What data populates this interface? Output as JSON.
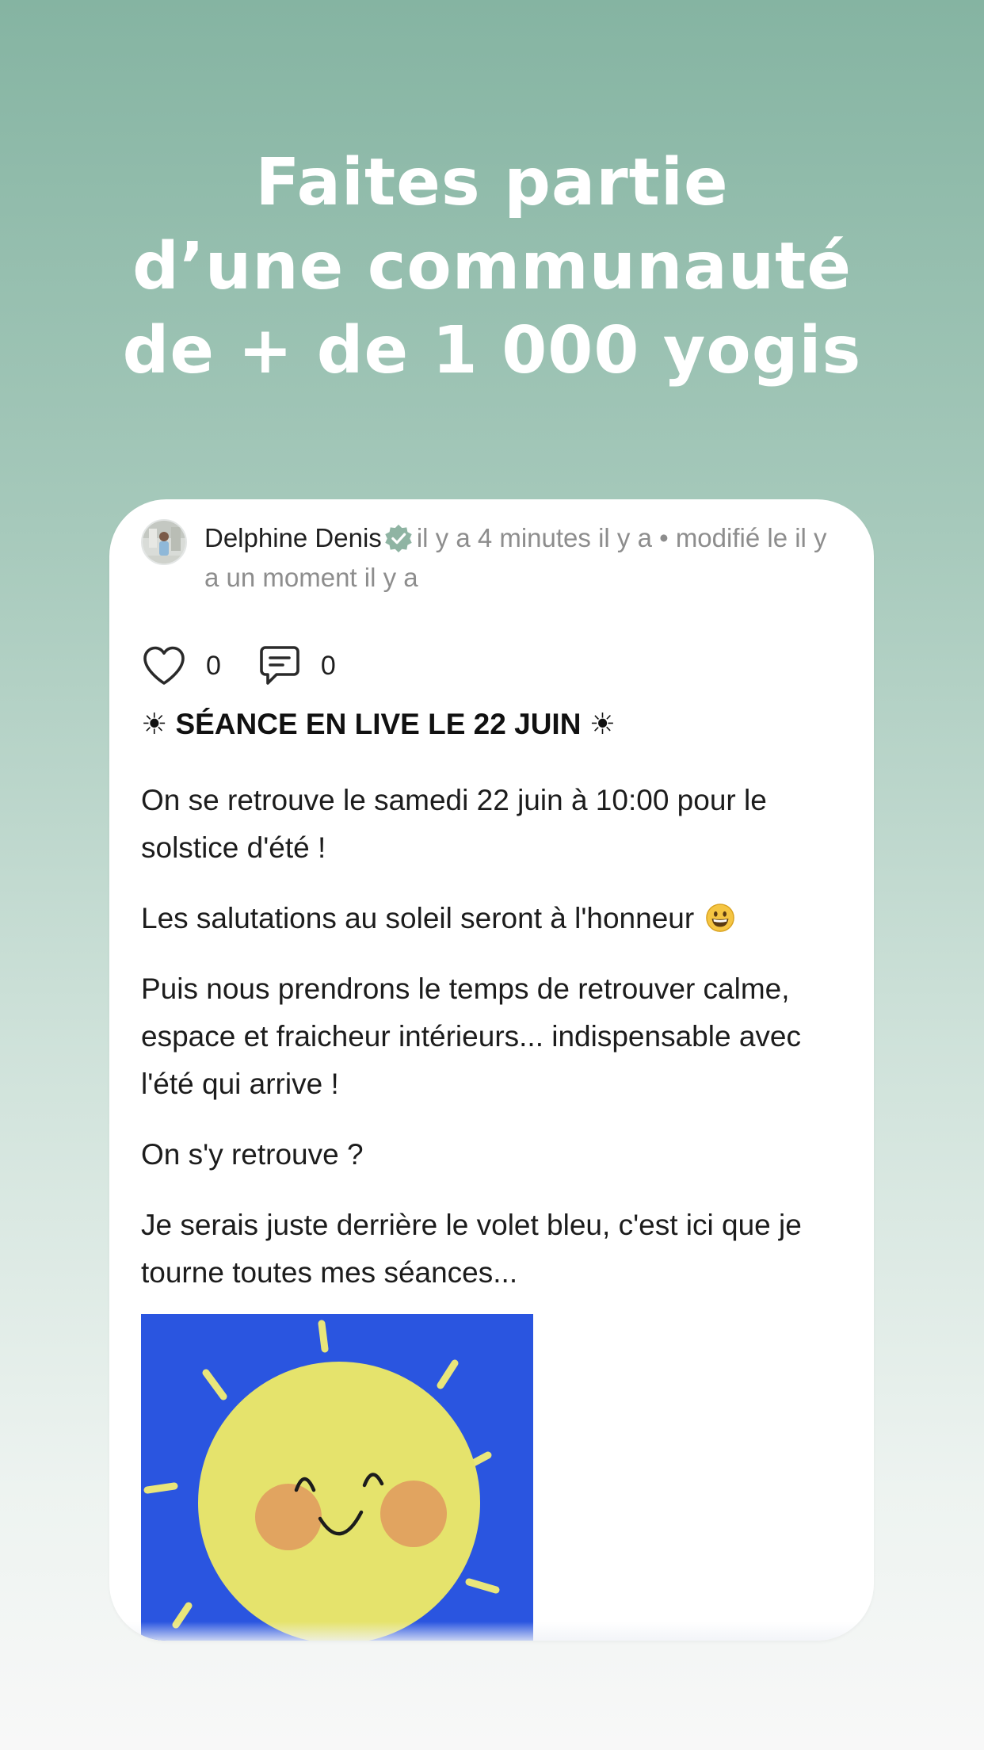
{
  "hero": {
    "title_lines": [
      "Faites partie",
      "d’une communauté",
      "de + de 1 000 yogis"
    ]
  },
  "post": {
    "author": "Delphine Denis",
    "meta_time": "il y a 4 minutes il y a • modifié le il y a un moment il y a",
    "likes": "0",
    "comments": "0",
    "title": "☀ SÉANCE EN LIVE LE 22 JUIN ☀",
    "paragraphs": [
      "On se retrouve le samedi 22 juin à 10:00 pour le solstice d'été !",
      "Les salutations au soleil seront à l'honneur",
      "Puis nous prendrons le temps de retrouver calme, espace et fraicheur intérieurs... indispensable avec l'été qui arrive !",
      "On s'y retrouve ?",
      "Je serais juste derrière le volet bleu, c'est ici que je tourne toutes mes séances..."
    ],
    "emoji": "grinning-face-emoji"
  },
  "colors": {
    "background_top": "#85b4a2",
    "background_bottom": "#f8f8f8",
    "verified_badge": "#8fb4a3",
    "image_background": "#2a55e0",
    "sun": "#e5e36c",
    "cheeks": "#e0a060"
  }
}
